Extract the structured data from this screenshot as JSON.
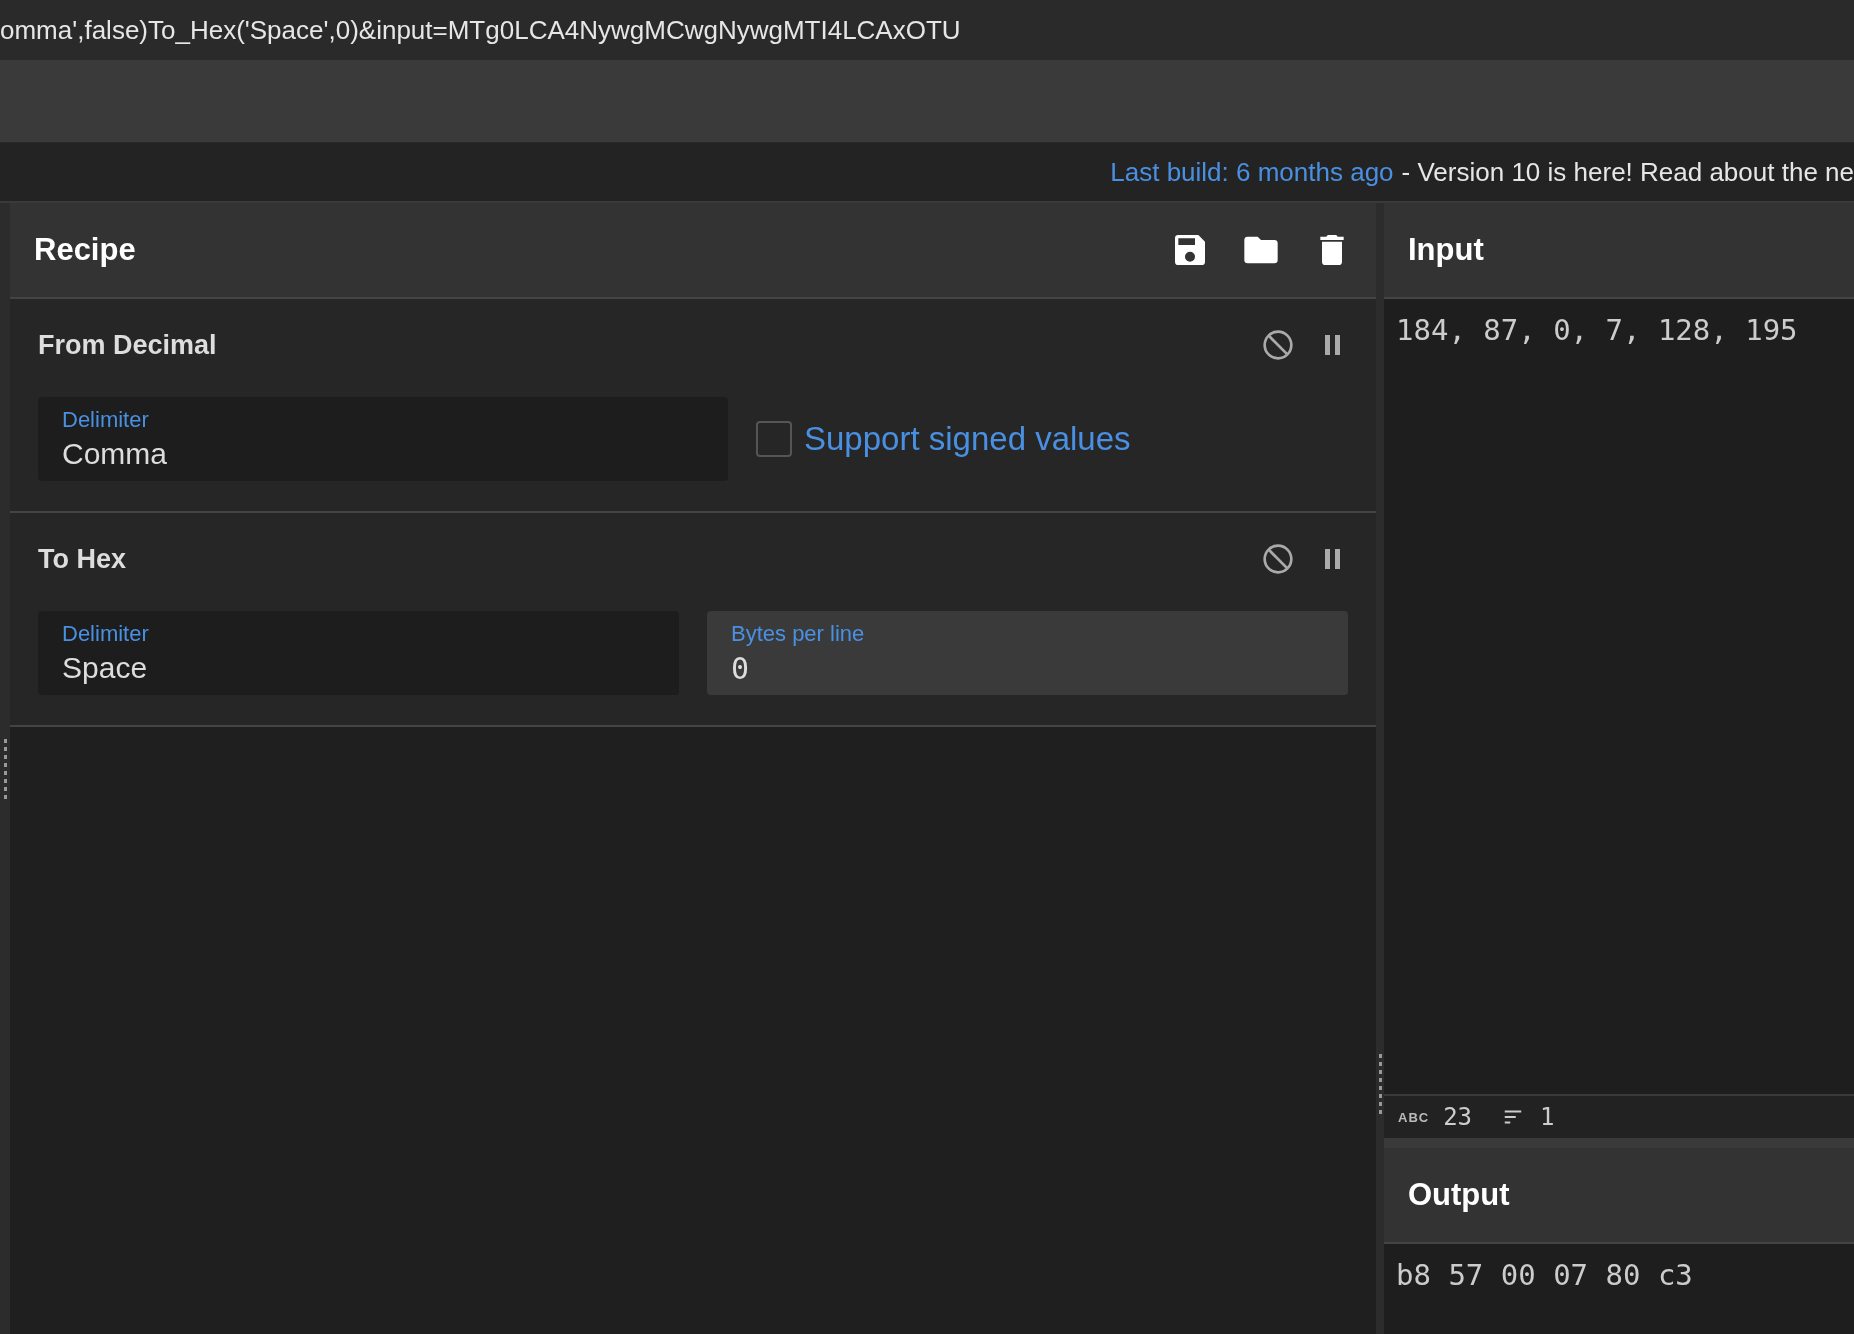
{
  "address_bar": {
    "url": "omma',false)To_Hex('Space',0)&input=MTg0LCA4NywgMCwgNywgMTI4LCAxOTU"
  },
  "notice": {
    "link": "Last build: 6 months ago",
    "text": "- Version 10 is here! Read about the ne"
  },
  "recipe": {
    "title": "Recipe",
    "operations": [
      {
        "name": "From Decimal",
        "disabled": false,
        "paused": false,
        "args": [
          {
            "kind": "dropdown",
            "label": "Delimiter",
            "value": "Comma"
          },
          {
            "kind": "checkbox",
            "label": "Support signed values",
            "checked": false
          }
        ]
      },
      {
        "name": "To Hex",
        "disabled": false,
        "paused": false,
        "args": [
          {
            "kind": "dropdown",
            "label": "Delimiter",
            "value": "Space"
          },
          {
            "kind": "number",
            "label": "Bytes per line",
            "value": "0"
          }
        ]
      }
    ]
  },
  "input": {
    "title": "Input",
    "value": "184, 87, 0, 7, 128, 195",
    "status": {
      "length_label": "ABC",
      "length": "23",
      "lines": "1"
    }
  },
  "output": {
    "title": "Output",
    "value": "b8 57 00 07 80 c3"
  }
}
